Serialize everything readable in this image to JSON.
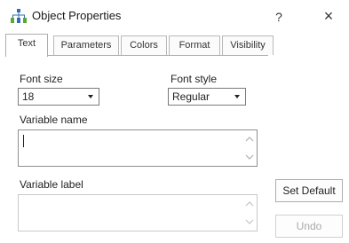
{
  "window": {
    "title": "Object Properties",
    "help_label": "?",
    "close_label": "×"
  },
  "tabs": [
    {
      "label": "Text",
      "active": true
    },
    {
      "label": "Parameters",
      "active": false
    },
    {
      "label": "Colors",
      "active": false
    },
    {
      "label": "Format",
      "active": false
    },
    {
      "label": "Visibility",
      "active": false
    }
  ],
  "text_tab": {
    "font_size_label": "Font size",
    "font_size_value": "18",
    "font_style_label": "Font style",
    "font_style_value": "Regular",
    "variable_name_label": "Variable name",
    "variable_name_value": "",
    "variable_label_label": "Variable label",
    "variable_label_value": ""
  },
  "buttons": {
    "set_default": "Set Default",
    "undo": "Undo"
  },
  "colors": {
    "app_icon": "#2f6fb3",
    "app_icon_accent": "#5aa832"
  }
}
